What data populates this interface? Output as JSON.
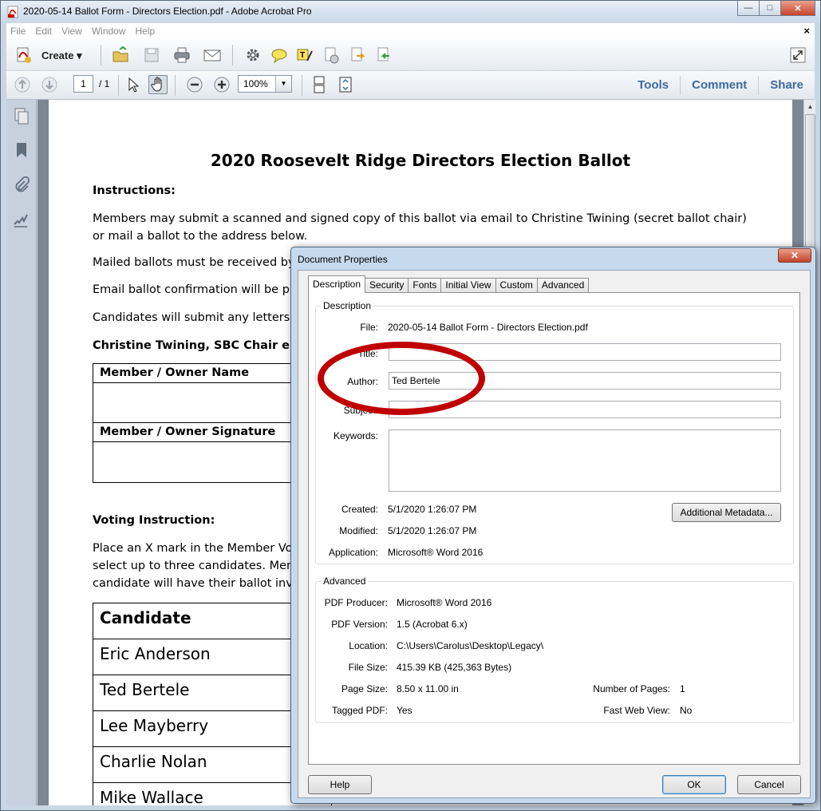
{
  "window": {
    "title": "2020-05-14 Ballot Form - Directors Election.pdf - Adobe Acrobat Pro",
    "min": "—",
    "max": "□",
    "close": "✕"
  },
  "menu": {
    "items": [
      "File",
      "Edit",
      "View",
      "Window",
      "Help"
    ],
    "close": "×"
  },
  "toolbar": {
    "create_label": "Create",
    "page_current": "1",
    "page_total": "/ 1",
    "zoom": "100%",
    "right_tabs": [
      "Tools",
      "Comment",
      "Share"
    ]
  },
  "document": {
    "title": "2020 Roosevelt Ridge Directors Election Ballot",
    "instructions_heading": "Instructions:",
    "para1": "Members may submit a scanned and signed copy of this ballot via email to Christine Twining (secret ballot chair) or mail a ballot to the address below.",
    "para2": "Mailed ballots must be received by M",
    "para3": "Email ballot confirmation will be pro",
    "para4": "Candidates will submit any letters to",
    "chair_email": "Christine Twining, SBC Chair email:",
    "sig_table": {
      "name_header": "Member / Owner Name",
      "signature_header": "Member / Owner Signature"
    },
    "voting_heading": "Voting Instruction:",
    "voting_line1": "Place an X mark in the Member Vote",
    "voting_line2": "select up to three candidates.  Meml",
    "voting_line3": "candidate will have their ballot inval",
    "candidates_header": "Candidate",
    "candidates": [
      "Eric Anderson",
      "Ted Bertele",
      "Lee Mayberry",
      "Charlie Nolan",
      "Mike Wallace"
    ]
  },
  "dialog": {
    "title": "Document Properties",
    "tabs": [
      "Description",
      "Security",
      "Fonts",
      "Initial View",
      "Custom",
      "Advanced"
    ],
    "description_group": "Description",
    "fields": {
      "file_label": "File:",
      "file_value": "2020-05-14 Ballot Form - Directors Election.pdf",
      "title_label": "Title:",
      "title_value": "",
      "author_label": "Author:",
      "author_value": "Ted Bertele",
      "subject_label": "Subject:",
      "subject_value": "",
      "keywords_label": "Keywords:",
      "keywords_value": ""
    },
    "created_label": "Created:",
    "created_value": "5/1/2020 1:26:07 PM",
    "modified_label": "Modified:",
    "modified_value": "5/1/2020 1:26:07 PM",
    "application_label": "Application:",
    "application_value": "Microsoft® Word 2016",
    "additional_metadata_button": "Additional Metadata...",
    "advanced_group": "Advanced",
    "advanced": {
      "producer_label": "PDF Producer:",
      "producer_value": "Microsoft® Word 2016",
      "version_label": "PDF Version:",
      "version_value": "1.5 (Acrobat 6.x)",
      "location_label": "Location:",
      "location_value": "C:\\Users\\Carolus\\Desktop\\Legacy\\",
      "filesize_label": "File Size:",
      "filesize_value": "415.39 KB (425,363 Bytes)",
      "pagesize_label": "Page Size:",
      "pagesize_value": "8.50 x 11.00 in",
      "numpages_label": "Number of Pages:",
      "numpages_value": "1",
      "tagged_label": "Tagged PDF:",
      "tagged_value": "Yes",
      "fastweb_label": "Fast Web View:",
      "fastweb_value": "No"
    },
    "buttons": {
      "help": "Help",
      "ok": "OK",
      "cancel": "Cancel"
    }
  }
}
